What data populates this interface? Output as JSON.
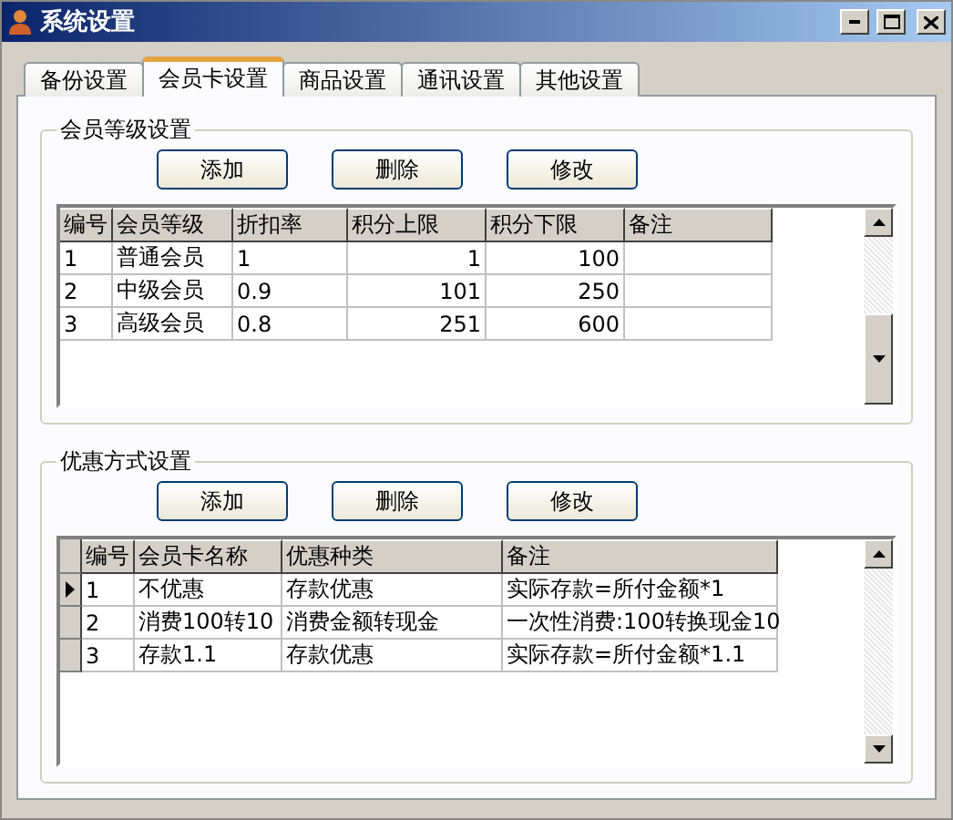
{
  "window": {
    "title": "系统设置"
  },
  "tabs": [
    {
      "label": "备份设置",
      "selected": false
    },
    {
      "label": "会员卡设置",
      "selected": true
    },
    {
      "label": "商品设置",
      "selected": false
    },
    {
      "label": "通讯设置",
      "selected": false
    },
    {
      "label": "其他设置",
      "selected": false
    }
  ],
  "groups": [
    {
      "title": "会员等级设置",
      "buttons": [
        "添加",
        "删除",
        "修改"
      ],
      "table": {
        "columns": [
          "编号",
          "会员等级",
          "折扣率",
          "积分上限",
          "积分下限",
          "备注"
        ],
        "rows": [
          {
            "cells": [
              "1",
              "普通会员",
              "1",
              "1",
              "100",
              ""
            ]
          },
          {
            "cells": [
              "2",
              "中级会员",
              "0.9",
              "101",
              "250",
              ""
            ]
          },
          {
            "cells": [
              "3",
              "高级会员",
              "0.8",
              "251",
              "600",
              ""
            ]
          }
        ]
      }
    },
    {
      "title": "优惠方式设置",
      "buttons": [
        "添加",
        "删除",
        "修改"
      ],
      "table": {
        "columns": [
          "编号",
          "会员卡名称",
          "优惠种类",
          "备注"
        ],
        "rows": [
          {
            "cells": [
              "1",
              "不优惠",
              "存款优惠",
              "实际存款=所付金额*1"
            ],
            "selected": true
          },
          {
            "cells": [
              "2",
              "消费100转10",
              "消费金额转现金",
              "一次性消费:100转换现金10"
            ],
            "selected": false
          },
          {
            "cells": [
              "3",
              "存款1.1",
              "存款优惠",
              "实际存款=所付金额*1.1"
            ],
            "selected": false
          }
        ]
      }
    }
  ]
}
